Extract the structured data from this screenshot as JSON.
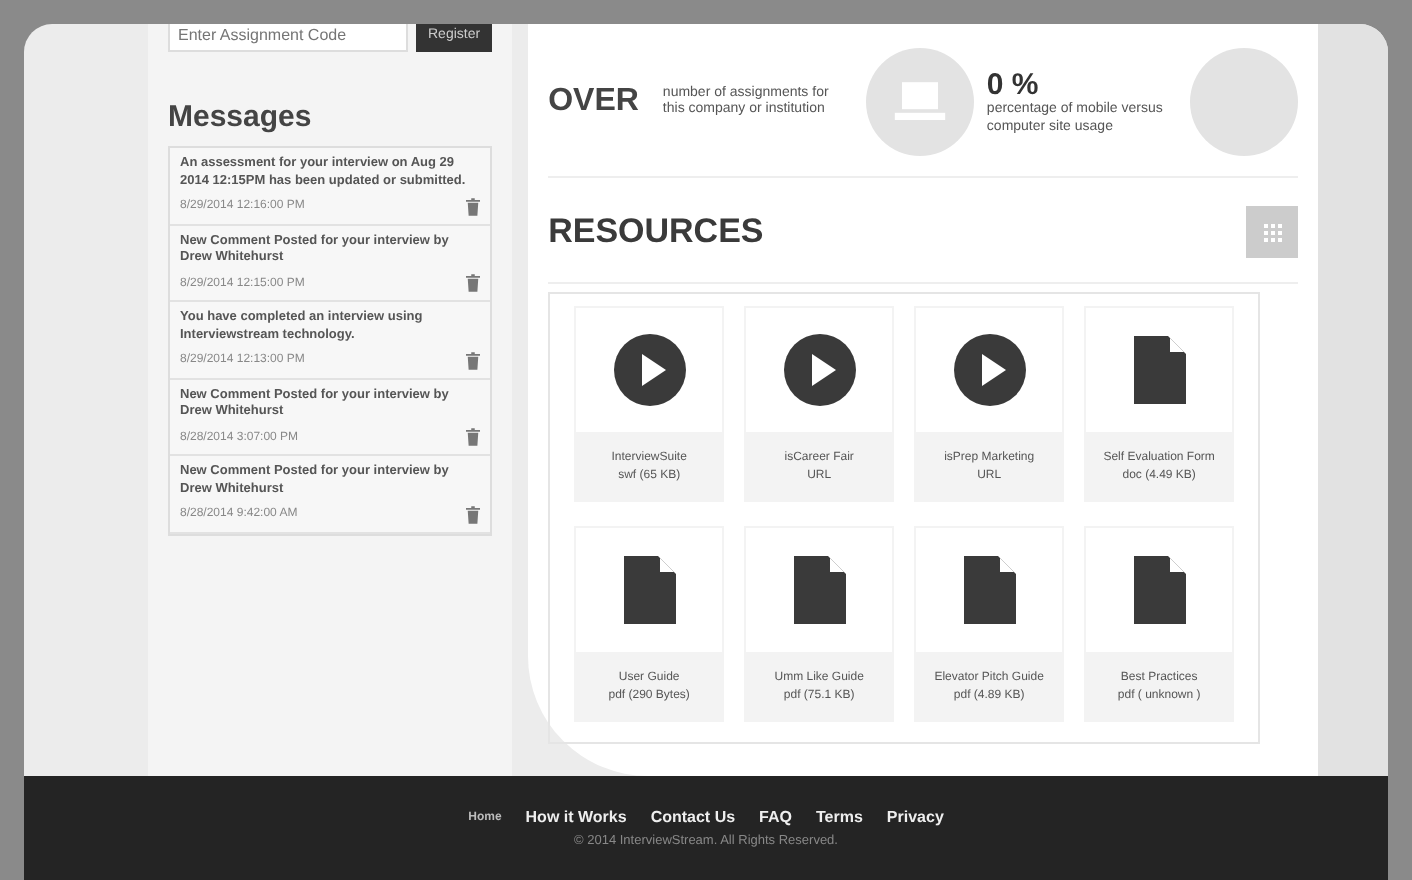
{
  "assignment": {
    "placeholder": "Enter Assignment Code",
    "button": "Register"
  },
  "messages": {
    "title": "Messages",
    "items": [
      {
        "text": "An assessment for your interview on Aug 29 2014 12:15PM has been updated or submitted.",
        "time": "8/29/2014 12:16:00 PM"
      },
      {
        "text": "New Comment Posted for your interview by Drew Whitehurst",
        "time": "8/29/2014 12:15:00 PM"
      },
      {
        "text": "You have completed an interview using Interviewstream technology.",
        "time": "8/29/2014 12:13:00 PM"
      },
      {
        "text": "New Comment Posted for your interview by Drew Whitehurst",
        "time": "8/28/2014 3:07:00 PM"
      },
      {
        "text": "New Comment Posted for your interview by Drew Whitehurst",
        "time": "8/28/2014 9:42:00 AM"
      }
    ]
  },
  "overview": {
    "title": "OVER",
    "stats": [
      {
        "label": "number of assignments for this company or institution"
      },
      {
        "value": "0 %",
        "label": "percentage of mobile versus computer site usage"
      }
    ]
  },
  "resources": {
    "title": "RESOURCES",
    "items": [
      {
        "kind": "video",
        "name": "InterviewSuite",
        "meta": "swf (65 KB)"
      },
      {
        "kind": "video",
        "name": "isCareer Fair",
        "meta": "URL"
      },
      {
        "kind": "video",
        "name": "isPrep Marketing",
        "meta": "URL"
      },
      {
        "kind": "document",
        "name": "Self Evaluation Form",
        "meta": "doc (4.49 KB)"
      },
      {
        "kind": "document",
        "name": "User Guide",
        "meta": "pdf (290 Bytes)"
      },
      {
        "kind": "document",
        "name": "Umm Like Guide",
        "meta": "pdf (75.1 KB)"
      },
      {
        "kind": "document",
        "name": "Elevator Pitch Guide",
        "meta": "pdf (4.89 KB)"
      },
      {
        "kind": "document",
        "name": "Best Practices",
        "meta": "pdf ( unknown )"
      }
    ]
  },
  "footer": {
    "links": [
      "Home",
      "How it Works",
      "Contact Us",
      "FAQ",
      "Terms",
      "Privacy"
    ],
    "copyright": "© 2014 InterviewStream. All Rights Reserved."
  }
}
